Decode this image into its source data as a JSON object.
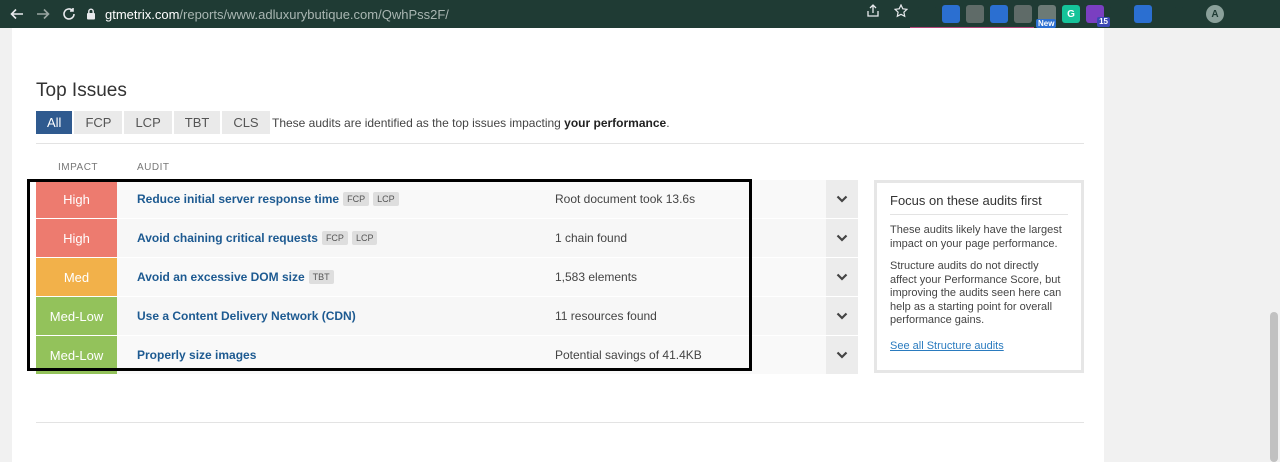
{
  "browser": {
    "url_host": "gtmetrix.com",
    "url_path": "/reports/www.adluxurybutique.com/QwhPss2F/",
    "extensions": [
      {
        "icon": "recycle-icon",
        "color": "#1f3b34"
      },
      {
        "icon": "doc-icon",
        "color": "#2b6fd1"
      },
      {
        "icon": "globe-icon",
        "color": "#5f6b68"
      },
      {
        "icon": "translate-icon",
        "color": "#2b6fd1"
      },
      {
        "icon": "camera-icon",
        "color": "#5f6b68"
      },
      {
        "icon": "new-ext-icon",
        "color": "#6c7a76",
        "badge": "New"
      },
      {
        "icon": "grammarly-icon",
        "color": "#15c39a",
        "label": "G"
      },
      {
        "icon": "adblock-icon",
        "color": "#7a3fc1",
        "badge": "15"
      },
      {
        "icon": "music-icon",
        "color": "#1f3b34"
      },
      {
        "icon": "sync-icon",
        "color": "#2b6fd1"
      },
      {
        "icon": "puzzle-icon",
        "color": "#1f3b34"
      },
      {
        "icon": "sidepanel-icon",
        "color": "#1f3b34"
      }
    ],
    "avatar": "A"
  },
  "section": {
    "title": "Top Issues",
    "tabs": [
      "All",
      "FCP",
      "LCP",
      "TBT",
      "CLS"
    ],
    "active_tab": "All",
    "note_prefix": "These audits are identified as the top issues impacting ",
    "note_bold": "your performance",
    "note_suffix": "."
  },
  "columns": {
    "impact": "IMPACT",
    "audit": "AUDIT"
  },
  "issues": [
    {
      "impact": "High",
      "impact_color": "#ed7b6f",
      "name": "Reduce initial server response time",
      "tags": [
        "FCP",
        "LCP"
      ],
      "detail": "Root document took 13.6s"
    },
    {
      "impact": "High",
      "impact_color": "#ed7b6f",
      "name": "Avoid chaining critical requests",
      "tags": [
        "FCP",
        "LCP"
      ],
      "detail": "1 chain found"
    },
    {
      "impact": "Med",
      "impact_color": "#f2b14a",
      "name": "Avoid an excessive DOM size",
      "tags": [
        "TBT"
      ],
      "detail": "1,583 elements"
    },
    {
      "impact": "Med-Low",
      "impact_color": "#93c25b",
      "name": "Use a Content Delivery Network (CDN)",
      "tags": [],
      "detail": "11 resources found"
    },
    {
      "impact": "Med-Low",
      "impact_color": "#93c25b",
      "name": "Properly size images",
      "tags": [],
      "detail": "Potential savings of 41.4KB"
    }
  ],
  "side_card": {
    "title": "Focus on these audits first",
    "p1": "These audits likely have the largest impact on your page performance.",
    "p2": "Structure audits do not directly affect your Performance Score, but improving the audits seen here can help as a starting point for overall performance gains.",
    "link": "See all Structure audits"
  }
}
